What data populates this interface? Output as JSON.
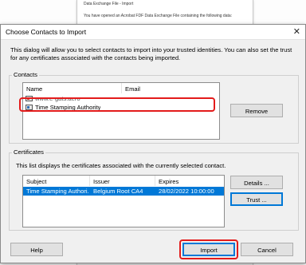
{
  "background_window": {
    "title": "Data Exchange File - Import",
    "text": "You have opened an Acrobat FDF Data Exchange File containing the following data:"
  },
  "dialog": {
    "title": "Choose Contacts to Import",
    "close": "✕",
    "intro": "This dialog will allow you to select contacts to import into your trusted identities. You can also set the trust for any certificates associated with the contacts being imported."
  },
  "contacts": {
    "label": "Contacts",
    "columns": {
      "name": "Name",
      "email": "Email"
    },
    "rows": [
      {
        "name": "www.e-gats.aero",
        "email": ""
      },
      {
        "name": "Time Stamping Authority",
        "email": ""
      }
    ],
    "remove_label": "Remove"
  },
  "certificates": {
    "label": "Certificates",
    "description": "This list displays the certificates associated with the currently selected contact.",
    "columns": {
      "subject": "Subject",
      "issuer": "Issuer",
      "expires": "Expires"
    },
    "rows": [
      {
        "subject": "Time Stamping Authori...",
        "issuer": "Belgium Root CA4",
        "expires": "28/02/2022 10:00:00"
      }
    ],
    "details_label": "Details ...",
    "trust_label": "Trust ..."
  },
  "footer": {
    "help_label": "Help",
    "import_label": "Import",
    "cancel_label": "Cancel"
  },
  "colors": {
    "highlight": "#e31b1b",
    "selection": "#0078d7"
  }
}
